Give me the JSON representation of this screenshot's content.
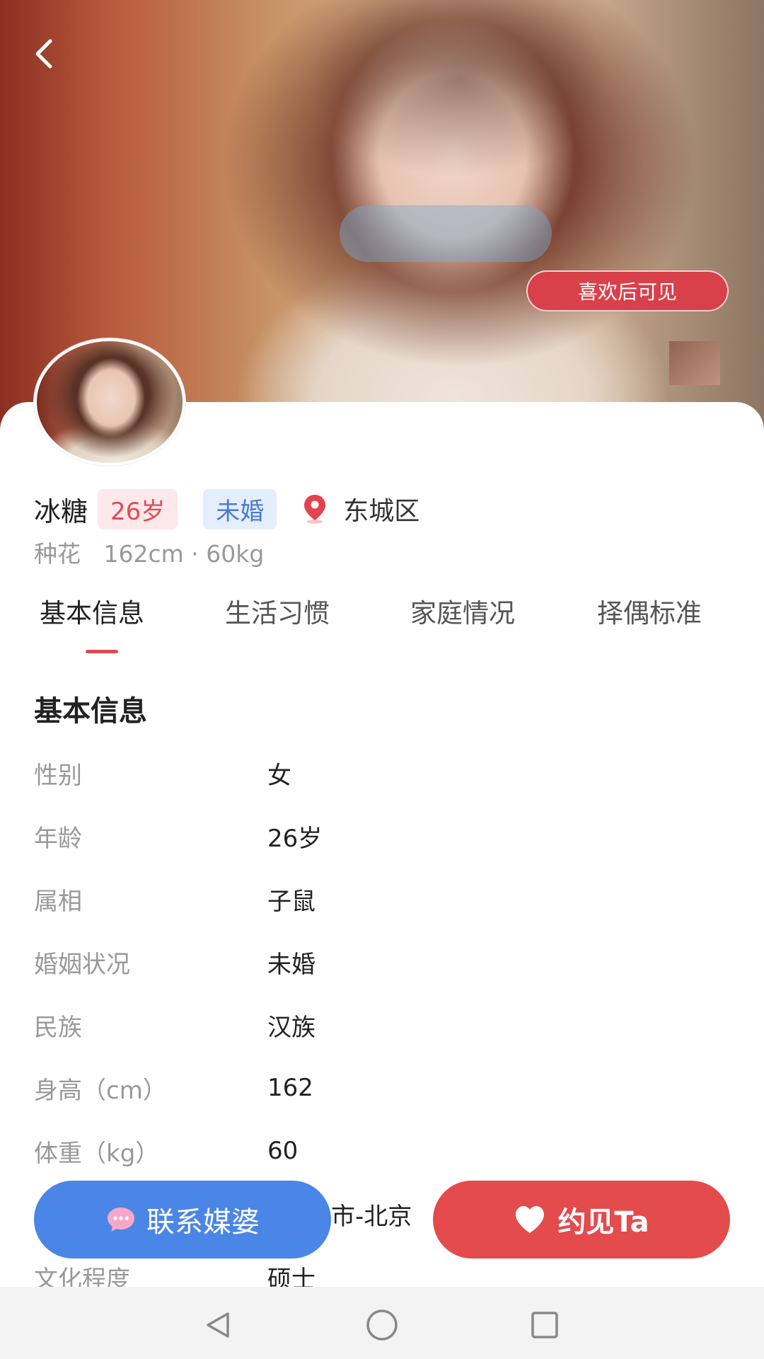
{
  "header": {
    "like_badge": "喜欢后可见"
  },
  "profile": {
    "name": "冰糖",
    "age_tag": "26岁",
    "marital_tag": "未婚",
    "location": "东城区",
    "zodiac": "种花",
    "height_weight": "162cm · 60kg"
  },
  "tabs": [
    {
      "label": "基本信息"
    },
    {
      "label": "生活习惯"
    },
    {
      "label": "家庭情况"
    },
    {
      "label": "择偶标准"
    }
  ],
  "section_title": "基本信息",
  "info_rows": [
    {
      "label": "性别",
      "value": "女"
    },
    {
      "label": "年龄",
      "value": "26岁"
    },
    {
      "label": "属相",
      "value": "子鼠"
    },
    {
      "label": "婚姻状况",
      "value": "未婚"
    },
    {
      "label": "民族",
      "value": "汉族"
    },
    {
      "label": "身高（cm）",
      "value": "162"
    },
    {
      "label": "体重（kg）",
      "value": "60"
    },
    {
      "label": "",
      "value": "市-北京"
    },
    {
      "label": "文化程度",
      "value": "硕士"
    }
  ],
  "actions": {
    "contact_label": "联系媒婆",
    "date_label": "约见Ta"
  },
  "colors": {
    "accent_red": "#e34b4d",
    "accent_blue": "#4a86e6",
    "tag_red": "#e04a55",
    "tag_blue": "#4b7ad0"
  },
  "icons": {
    "back": "chevron-left-icon",
    "location": "map-pin-icon",
    "chat": "chat-bubble-icon",
    "heart": "heart-icon",
    "nav_back": "triangle-back-icon",
    "nav_home": "circle-home-icon",
    "nav_recent": "square-recent-icon"
  }
}
